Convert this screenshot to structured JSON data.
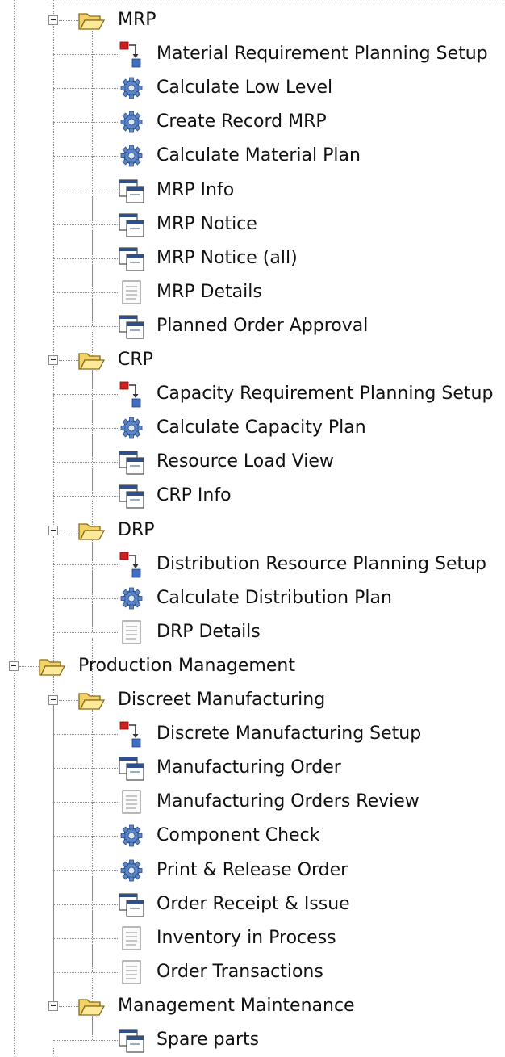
{
  "tree": {
    "nodes": [
      {
        "kind": "folder",
        "depth": 1,
        "label": "MRP",
        "expanded": true,
        "icon": "folder-open-icon"
      },
      {
        "kind": "leaf",
        "depth": 2,
        "label": "Material Requirement Planning Setup",
        "icon": "workflow-icon"
      },
      {
        "kind": "leaf",
        "depth": 2,
        "label": "Calculate Low Level",
        "icon": "process-gear-icon"
      },
      {
        "kind": "leaf",
        "depth": 2,
        "label": "Create Record MRP",
        "icon": "process-gear-icon"
      },
      {
        "kind": "leaf",
        "depth": 2,
        "label": "Calculate Material Plan",
        "icon": "process-gear-icon"
      },
      {
        "kind": "leaf",
        "depth": 2,
        "label": "MRP Info",
        "icon": "window-icon"
      },
      {
        "kind": "leaf",
        "depth": 2,
        "label": "MRP Notice",
        "icon": "window-icon"
      },
      {
        "kind": "leaf",
        "depth": 2,
        "label": "MRP Notice (all)",
        "icon": "window-icon"
      },
      {
        "kind": "leaf",
        "depth": 2,
        "label": "MRP Details",
        "icon": "report-icon"
      },
      {
        "kind": "leaf",
        "depth": 2,
        "label": "Planned Order Approval",
        "icon": "window-icon"
      },
      {
        "kind": "folder",
        "depth": 1,
        "label": "CRP",
        "expanded": true,
        "icon": "folder-open-icon"
      },
      {
        "kind": "leaf",
        "depth": 2,
        "label": "Capacity Requirement Planning Setup",
        "icon": "workflow-icon"
      },
      {
        "kind": "leaf",
        "depth": 2,
        "label": "Calculate Capacity Plan",
        "icon": "process-gear-icon"
      },
      {
        "kind": "leaf",
        "depth": 2,
        "label": "Resource Load View",
        "icon": "window-icon"
      },
      {
        "kind": "leaf",
        "depth": 2,
        "label": "CRP Info",
        "icon": "window-icon"
      },
      {
        "kind": "folder",
        "depth": 1,
        "label": "DRP",
        "expanded": true,
        "icon": "folder-open-icon"
      },
      {
        "kind": "leaf",
        "depth": 2,
        "label": "Distribution Resource Planning Setup",
        "icon": "workflow-icon"
      },
      {
        "kind": "leaf",
        "depth": 2,
        "label": "Calculate Distribution Plan",
        "icon": "process-gear-icon"
      },
      {
        "kind": "leaf",
        "depth": 2,
        "label": "DRP Details",
        "icon": "report-icon"
      },
      {
        "kind": "folder",
        "depth": 0,
        "label": "Production Management",
        "expanded": true,
        "icon": "folder-open-icon"
      },
      {
        "kind": "folder",
        "depth": 1,
        "label": "Discreet Manufacturing",
        "expanded": true,
        "icon": "folder-open-icon"
      },
      {
        "kind": "leaf",
        "depth": 2,
        "label": "Discrete Manufacturing Setup",
        "icon": "workflow-icon"
      },
      {
        "kind": "leaf",
        "depth": 2,
        "label": "Manufacturing Order",
        "icon": "window-icon"
      },
      {
        "kind": "leaf",
        "depth": 2,
        "label": "Manufacturing Orders Review",
        "icon": "report-icon"
      },
      {
        "kind": "leaf",
        "depth": 2,
        "label": "Component Check",
        "icon": "process-gear-icon"
      },
      {
        "kind": "leaf",
        "depth": 2,
        "label": "Print & Release Order",
        "icon": "process-gear-icon"
      },
      {
        "kind": "leaf",
        "depth": 2,
        "label": "Order Receipt & Issue",
        "icon": "window-icon"
      },
      {
        "kind": "leaf",
        "depth": 2,
        "label": "Inventory in Process",
        "icon": "report-icon"
      },
      {
        "kind": "leaf",
        "depth": 2,
        "label": "Order Transactions",
        "icon": "report-icon"
      },
      {
        "kind": "folder",
        "depth": 1,
        "label": "Management Maintenance",
        "expanded": true,
        "icon": "folder-open-icon"
      },
      {
        "kind": "leaf",
        "depth": 2,
        "label": "Spare parts",
        "icon": "window-icon"
      }
    ]
  }
}
